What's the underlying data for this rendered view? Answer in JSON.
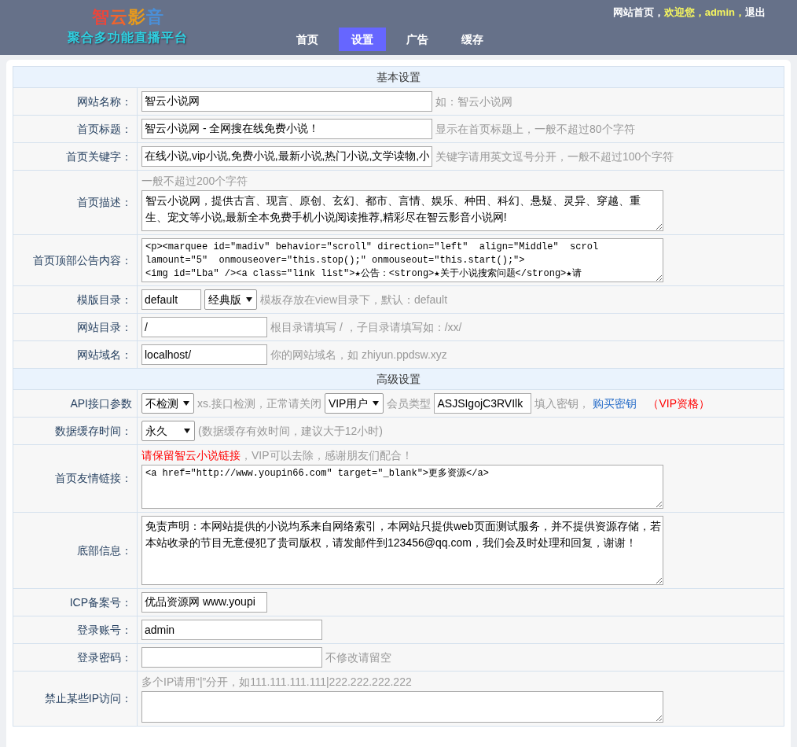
{
  "header": {
    "logo_chars": [
      {
        "text": "智",
        "color": "#e8473d"
      },
      {
        "text": "云",
        "color": "#f0642d"
      },
      {
        "text": "影",
        "color": "#e89a1c"
      },
      {
        "text": "音",
        "color": "#4a8fd8"
      }
    ],
    "subtitle": "聚合多功能直播平台",
    "nav": [
      {
        "label": "首页",
        "selected": false
      },
      {
        "label": "设置",
        "selected": true
      },
      {
        "label": "广告",
        "selected": false
      },
      {
        "label": "缓存",
        "selected": false
      }
    ],
    "user_links": [
      {
        "text": "网站首页，",
        "kind": "link"
      },
      {
        "text": "欢迎您，admin，",
        "kind": "greeting"
      },
      {
        "text": "退出",
        "kind": "link"
      }
    ]
  },
  "rows": [
    {
      "kind": "section",
      "title": "基本设置"
    },
    {
      "kind": "field",
      "label": "网站名称：",
      "controls": [
        {
          "kind": "input",
          "value": "智云小说网"
        },
        {
          "kind": "hint",
          "text": "如：智云小说网"
        }
      ]
    },
    {
      "kind": "field",
      "label": "首页标题：",
      "controls": [
        {
          "kind": "input",
          "value": "智云小说网 - 全网搜在线免费小说！"
        },
        {
          "kind": "hint",
          "text": "显示在首页标题上，一般不超过80个字符"
        }
      ]
    },
    {
      "kind": "field",
      "label": "首页关键字：",
      "controls": [
        {
          "kind": "input",
          "value": "在线小说,vip小说,免费小说,最新小说,热门小说,文学读物,小"
        },
        {
          "kind": "hint",
          "text": "关键字请用英文逗号分开，一般不超过100个字符"
        }
      ]
    },
    {
      "kind": "field",
      "label": "首页描述：",
      "note": [
        {
          "kind": "hint",
          "text": "一般不超过200个字符"
        }
      ],
      "controls": [
        {
          "kind": "textarea",
          "lines": [
            "智云小说网，提供古言、现言、原创、玄幻、都市、言情、娱乐、种田、科幻、悬疑、灵异、穿越、重",
            "生、宠文等小说,最新全本免费手机小说阅读推荐,精彩尽在智云影音小说网!"
          ]
        }
      ]
    },
    {
      "kind": "field",
      "label": "首页顶部公告内容：",
      "controls": [
        {
          "kind": "code",
          "lines": [
            "<p><marquee id=\"madiv\" behavior=\"scroll\" direction=\"left\"  align=\"Middle\"  scrol",
            "lamount=\"5\"  onmouseover=\"this.stop();\" onmouseout=\"this.start();\">",
            "<img id=\"Lba\" /><a class=\"link list\">★公告：<strong>★关于小说搜索问题</strong>★请"
          ]
        }
      ]
    },
    {
      "kind": "field",
      "label": "模版目录：",
      "controls": [
        {
          "kind": "input",
          "value": "default"
        },
        {
          "kind": "select",
          "value": "经典版"
        },
        {
          "kind": "hint",
          "text": "模板存放在view目录下，默认：default"
        }
      ]
    },
    {
      "kind": "field",
      "label": "网站目录：",
      "controls": [
        {
          "kind": "input",
          "value": "/"
        },
        {
          "kind": "hint",
          "text": "根目录请填写 / ，子目录请填写如：/xx/"
        }
      ]
    },
    {
      "kind": "field",
      "label": "网站域名：",
      "controls": [
        {
          "kind": "input",
          "value": "localhost/"
        },
        {
          "kind": "hint",
          "text": "你的网站域名，如 zhiyun.ppdsw.xyz"
        }
      ]
    },
    {
      "kind": "section",
      "title": "高级设置"
    },
    {
      "kind": "field",
      "label": "API接口参数",
      "controls": [
        {
          "kind": "select",
          "value": "不检测"
        },
        {
          "kind": "hint",
          "text": "xs.接口检测，正常请关闭"
        },
        {
          "kind": "select",
          "value": "VIP用户"
        },
        {
          "kind": "hint",
          "text": "会员类型"
        },
        {
          "kind": "input",
          "value": "ASJSIgojC3RVIlk"
        },
        {
          "kind": "hint",
          "text": "填入密钥，"
        },
        {
          "kind": "link",
          "text": "购买密钥"
        },
        {
          "kind": "warning",
          "text": "（VIP资格）"
        }
      ]
    },
    {
      "kind": "field",
      "label": "数据缓存时间：",
      "controls": [
        {
          "kind": "select",
          "value": "永久"
        },
        {
          "kind": "hint",
          "text": "(数据缓存有效时间，建议大于12小时)"
        }
      ]
    },
    {
      "kind": "field",
      "label": "首页友情链接：",
      "note": [
        {
          "kind": "warning",
          "text": "请保留智云小说链接"
        },
        {
          "kind": "hint",
          "text": "，VIP可以去除，感谢朋友们配合！"
        }
      ],
      "controls": [
        {
          "kind": "code",
          "lines": [
            "<a href=\"http://www.youpin66.com\" target=\"_blank\">更多资源</a>"
          ]
        }
      ]
    },
    {
      "kind": "field",
      "label": "底部信息：",
      "controls": [
        {
          "kind": "textarea",
          "lines": [
            "免责声明：本网站提供的小说均系来自网络索引，本网站只提供web页面测试服务，并不提供资源存储，若",
            "本站收录的节目无意侵犯了贵司版权，请发邮件到123456@qq.com，我们会及时处理和回复，谢谢！"
          ]
        }
      ]
    },
    {
      "kind": "field",
      "label": "ICP备案号：",
      "controls": [
        {
          "kind": "input",
          "value": "优品资源网 www.youpi"
        }
      ]
    },
    {
      "kind": "field",
      "label": "登录账号：",
      "controls": [
        {
          "kind": "input",
          "value": "admin"
        }
      ]
    },
    {
      "kind": "field",
      "label": "登录密码：",
      "controls": [
        {
          "kind": "input"
        },
        {
          "kind": "hint",
          "text": "不修改请留空"
        }
      ]
    },
    {
      "kind": "field",
      "label": "禁止某些IP访问：",
      "note": [
        {
          "kind": "hint",
          "text": "多个IP请用“|”分开，如111.111.111.111|222.222.222.222"
        }
      ],
      "controls": [
        {
          "kind": "textarea"
        }
      ]
    }
  ]
}
